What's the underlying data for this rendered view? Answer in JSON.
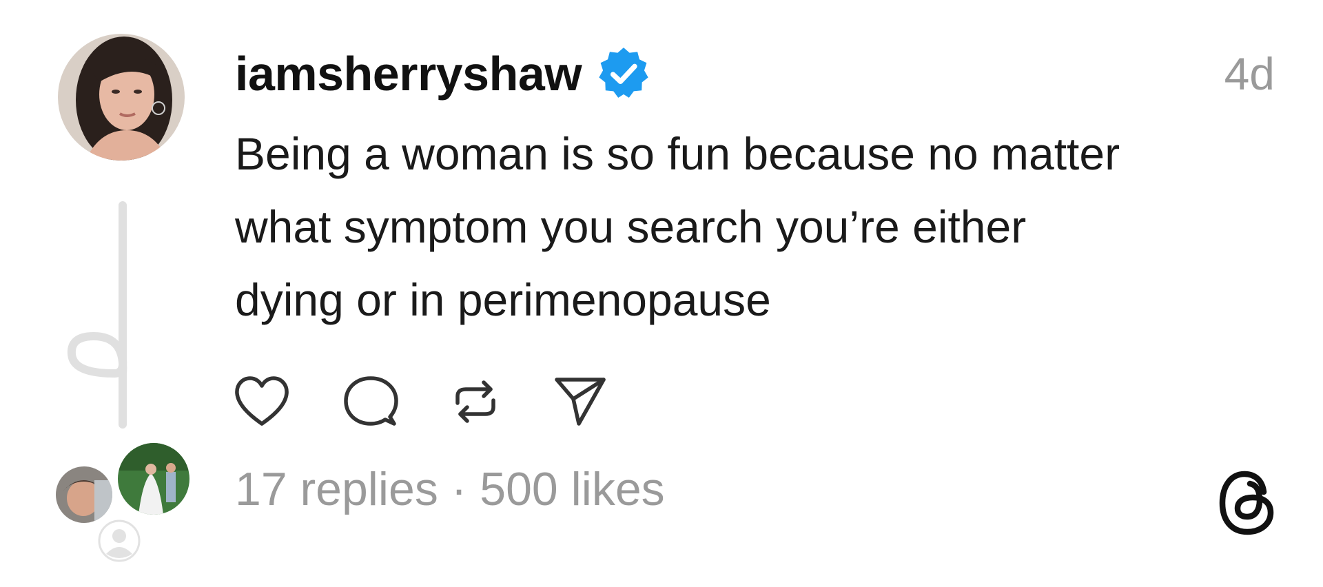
{
  "post": {
    "username": "iamsherryshaw",
    "verified": true,
    "timestamp": "4d",
    "text_lines": [
      "Being a woman is so fun because no matter",
      "what symptom you search you’re either",
      "dying or in perimenopause"
    ],
    "stats": {
      "replies": "17 replies",
      "separator": " · ",
      "likes": "500 likes"
    }
  },
  "icons": {
    "verified": "verified-badge-icon",
    "like": "heart-icon",
    "reply": "comment-icon",
    "repost": "repost-icon",
    "share": "send-icon",
    "brand": "threads-logo-icon"
  },
  "colors": {
    "text": "#1a1a1a",
    "muted": "#9a9a9a",
    "verified_blue": "#1d9bf0",
    "thread_line": "#e0e0e0",
    "icon_stroke": "#333333"
  }
}
